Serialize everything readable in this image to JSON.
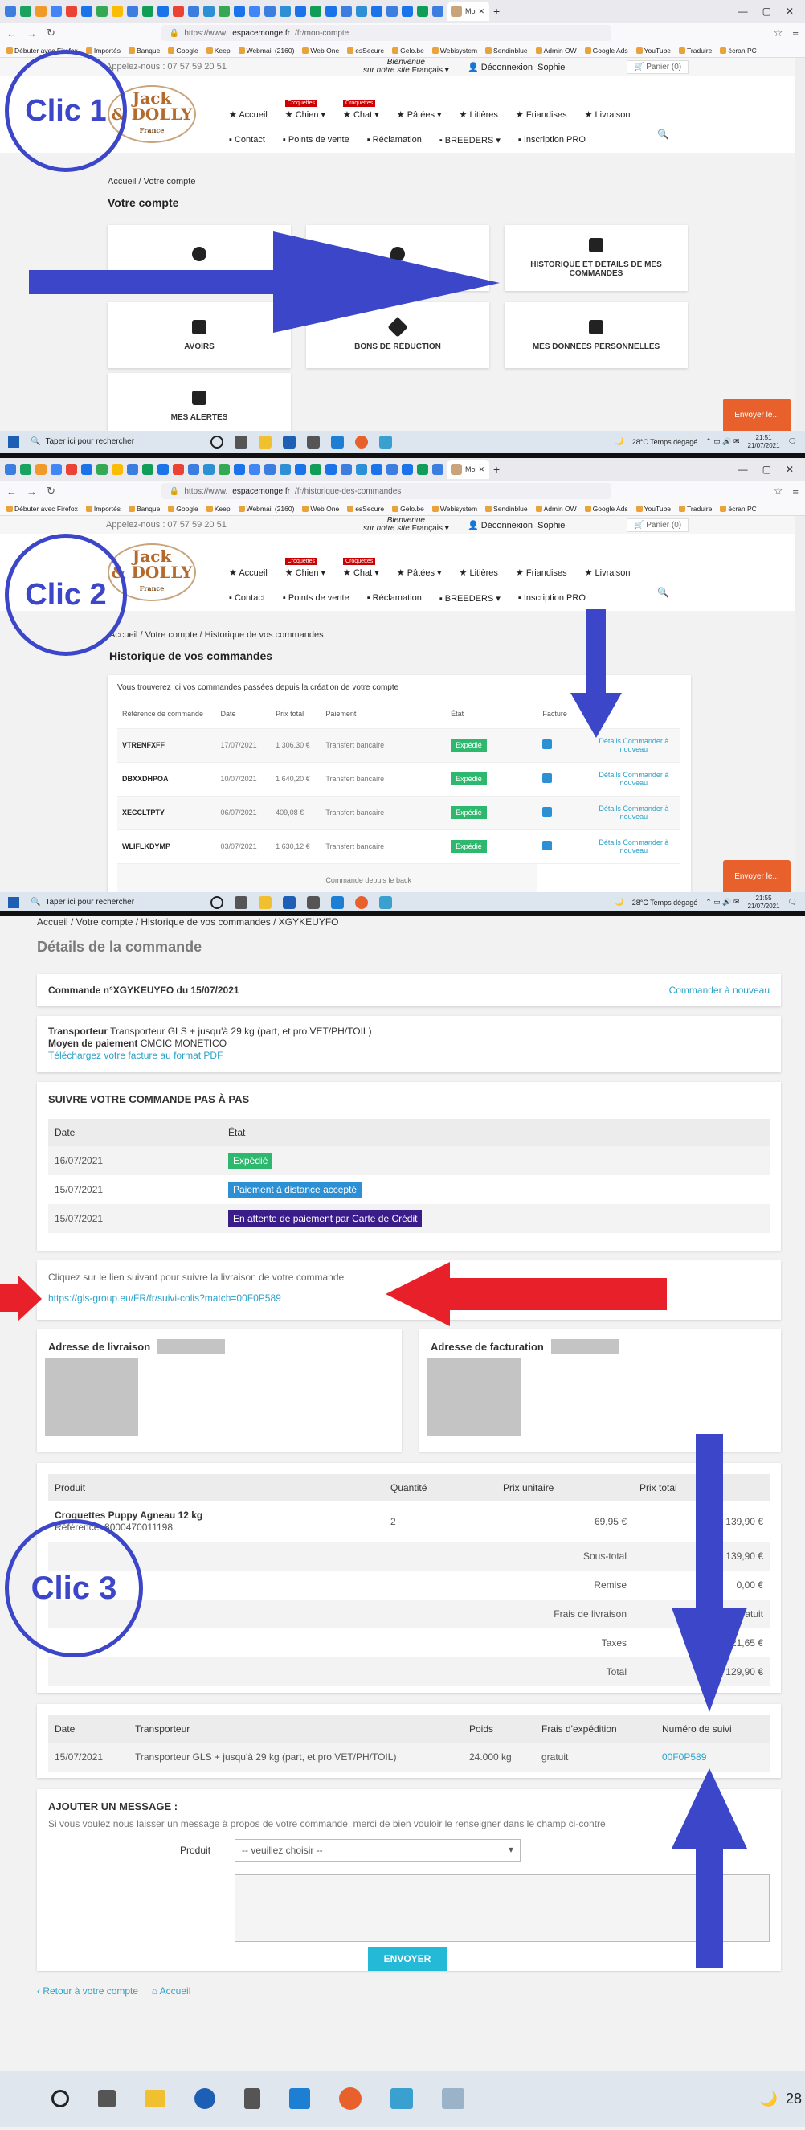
{
  "browser": {
    "tab_title": "Mo",
    "url_host_1": "https://www.",
    "url_domain_1": "espacemonge.fr",
    "url_path_1": "/fr/mon-compte",
    "url_host_2": "https://www.",
    "url_domain_2": "espacemonge.fr",
    "url_path_2": "/fr/historique-des-commandes",
    "bookmarks": [
      "Débuter avec Firefox",
      "Importés",
      "Banque",
      "Google",
      "Keep",
      "Webmail (2160)",
      "Web One",
      "esSecure",
      "Gelo.be",
      "Webisystem",
      "Sendinblue",
      "Admin OW",
      "Google Ads",
      "YouTube",
      "Traduire",
      "écran PC"
    ]
  },
  "site": {
    "phone": "Appelez-nous : 07 57 59 20 51",
    "welcome": "Bienvenue",
    "welcome_sub": "sur notre site",
    "language": "Français ▾",
    "logout": "Déconnexion",
    "user": "Sophie",
    "cart": "Panier (0)",
    "logo_line1": "Jack",
    "logo_line2": "& DOLLY",
    "logo_sub": "France",
    "menu_row1": [
      {
        "label": "Accueil",
        "tag": ""
      },
      {
        "label": "Chien ▾",
        "tag": "Croquettes"
      },
      {
        "label": "Chat ▾",
        "tag": "Croquettes"
      },
      {
        "label": "Pâtées ▾",
        "tag": ""
      },
      {
        "label": "Litières",
        "tag": ""
      },
      {
        "label": "Friandises",
        "tag": ""
      },
      {
        "label": "Livraison",
        "tag": ""
      }
    ],
    "menu_row2": [
      "Contact",
      "Points de vente",
      "Réclamation",
      "BREEDERS ▾",
      "Inscription PRO"
    ],
    "feedback": "Envoyer le..."
  },
  "panel1": {
    "breadcrumb": "Accueil  /  Votre compte",
    "title": "Votre compte",
    "cards": [
      "",
      "",
      "Historique et détails de mes commandes",
      "Avoirs",
      "Bons de réduction",
      "Mes données personnelles",
      "Mes alertes"
    ]
  },
  "panel2": {
    "breadcrumb": "Accueil  /  Votre compte  /  Historique de vos commandes",
    "title": "Historique de vos commandes",
    "intro": "Vous trouverez ici vos commandes passées depuis la création de votre compte",
    "headers": [
      "Référence de commande",
      "Date",
      "Prix total",
      "Paiement",
      "État",
      "Facture",
      ""
    ],
    "rows": [
      {
        "ref": "VTRENFXFF",
        "date": "17/07/2021",
        "total": "1 306,30 €",
        "payment": "Transfert bancaire",
        "state": "Expédié",
        "action": "Détails  Commander à nouveau"
      },
      {
        "ref": "DBXXDHPOA",
        "date": "10/07/2021",
        "total": "1 640,20 €",
        "payment": "Transfert bancaire",
        "state": "Expédié",
        "action": "Détails  Commander à nouveau"
      },
      {
        "ref": "XECCLTPTY",
        "date": "06/07/2021",
        "total": "409,08 €",
        "payment": "Transfert bancaire",
        "state": "Expédié",
        "action": "Détails  Commander à nouveau"
      },
      {
        "ref": "WLIFLKDYMP",
        "date": "03/07/2021",
        "total": "1 630,12 €",
        "payment": "Transfert bancaire",
        "state": "Expédié",
        "action": "Détails  Commander à nouveau"
      }
    ],
    "partial_row": "Commande depuis le back"
  },
  "taskbar": {
    "search": "Taper ici pour rechercher",
    "weather": "28°C  Temps dégagé",
    "time_1": "21:51",
    "date_1": "21/07/2021",
    "time_2": "21:55",
    "date_2": "21/07/2021",
    "weather_short": "28"
  },
  "panel3": {
    "breadcrumb": "Accueil  /  Votre compte  /  Historique de vos commandes  /  XGYKEUYFO",
    "title": "Détails de la commande",
    "order_line": "Commande n°XGYKEUYFO du 15/07/2021",
    "reorder": "Commander à nouveau",
    "carrier_label": "Transporteur",
    "carrier_value": "Transporteur GLS + jusqu'à 29 kg (part, et pro VET/PH/TOIL)",
    "payment_label": "Moyen de paiement",
    "payment_value": "CMCIC MONETICO",
    "invoice_link": "Téléchargez votre facture au format PDF",
    "follow_title": "SUIVRE VOTRE COMMANDE PAS À PAS",
    "follow_headers": [
      "Date",
      "État"
    ],
    "follow_rows": [
      {
        "date": "16/07/2021",
        "state": "Expédié",
        "color": "#2eb86e"
      },
      {
        "date": "15/07/2021",
        "state": "Paiement à distance accepté",
        "color": "#2d8fd4"
      },
      {
        "date": "15/07/2021",
        "state": "En attente de paiement par Carte de Crédit",
        "color": "#3b1d8a"
      }
    ],
    "tracking_text": "Cliquez sur le lien suivant pour suivre la livraison de votre commande",
    "tracking_link": "https://gls-group.eu/FR/fr/suivi-colis?match=00F0P589",
    "delivery_addr": "Adresse de livraison",
    "billing_addr": "Adresse de facturation",
    "product_headers": [
      "Produit",
      "Quantité",
      "Prix unitaire",
      "Prix total"
    ],
    "product_name": "Croquettes Puppy Agneau 12 kg",
    "product_ref": "Référence: 8000470011198",
    "product_qty": "2",
    "product_unit": "69,95 €",
    "product_total": "139,90 €",
    "totals": [
      {
        "label": "Sous-total",
        "value": "139,90 €"
      },
      {
        "label": "Remise",
        "value": "0,00 €"
      },
      {
        "label": "Frais de livraison",
        "value": "gratuit"
      },
      {
        "label": "Taxes",
        "value": "21,65 €"
      },
      {
        "label": "Total",
        "value": "129,90 €"
      }
    ],
    "ship_headers": [
      "Date",
      "Transporteur",
      "Poids",
      "Frais d'expédition",
      "Numéro de suivi"
    ],
    "ship_row": {
      "date": "15/07/2021",
      "carrier": "Transporteur GLS + jusqu'à 29 kg (part, et pro VET/PH/TOIL)",
      "weight": "24.000 kg",
      "fee": "gratuit",
      "tracking": "00F0P589"
    },
    "message_title": "AJOUTER UN MESSAGE :",
    "message_text": "Si vous voulez nous laisser un message à propos de votre commande, merci de bien vouloir le renseigner dans le champ ci-contre",
    "product_label": "Produit",
    "select_value": "-- veuillez choisir --",
    "send": "ENVOYER",
    "back_link": "Retour à votre compte",
    "home_link": "Accueil"
  },
  "annotations": {
    "clic1": "Clic 1",
    "clic2": "Clic 2",
    "clic3": "Clic 3",
    "arrow_blue": "#3c46c8",
    "arrow_red": "#e8202a"
  }
}
